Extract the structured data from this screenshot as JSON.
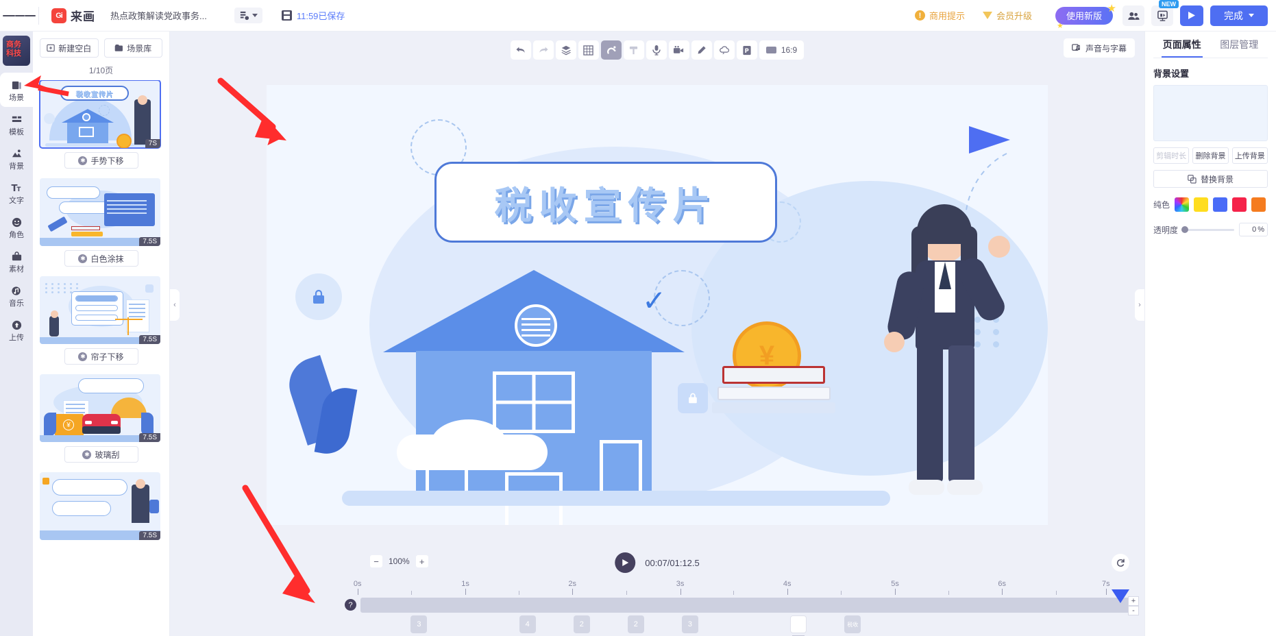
{
  "header": {
    "menu_icon": "hamburger-icon",
    "brand_mark": "Gi",
    "brand_name": "来画",
    "doc_title": "热点政策解读党政事务...",
    "mode_icon": "layout-mode-icon",
    "save_icon": "save-icon",
    "save_status": "11:59已保存",
    "commercial_notice": "商用提示",
    "vip_upgrade": "会员升级",
    "new_version": "使用新版",
    "collab_icon": "collaborators-icon",
    "present_icon": "present-icon",
    "new_badge": "NEW",
    "preview_icon": "play-icon",
    "done_label": "完成"
  },
  "rail": {
    "project_thumb_label": "商务\n科技",
    "items": [
      {
        "label": "场景",
        "icon": "scene-icon",
        "active": true
      },
      {
        "label": "模板",
        "icon": "template-icon",
        "active": false
      },
      {
        "label": "背景",
        "icon": "background-icon",
        "active": false
      },
      {
        "label": "文字",
        "icon": "text-icon",
        "active": false
      },
      {
        "label": "角色",
        "icon": "character-icon",
        "active": false
      },
      {
        "label": "素材",
        "icon": "material-icon",
        "active": false
      },
      {
        "label": "音乐",
        "icon": "music-icon",
        "active": false
      },
      {
        "label": "上传",
        "icon": "upload-icon",
        "active": false
      }
    ]
  },
  "scenes": {
    "new_blank": "新建空白",
    "scene_library": "场景库",
    "page_count": "1/10页",
    "items": [
      {
        "duration": "7S",
        "effect": "手势下移",
        "selected": true
      },
      {
        "duration": "7.5S",
        "effect": "白色涂抹",
        "selected": false
      },
      {
        "duration": "7.5S",
        "effect": "帘子下移",
        "selected": false
      },
      {
        "duration": "7.5S",
        "effect": "玻璃刮",
        "selected": false
      },
      {
        "duration": "7.5S",
        "effect": "",
        "selected": false
      }
    ]
  },
  "toolbar": {
    "buttons": [
      {
        "icon": "undo-icon",
        "name": "undo-button",
        "state": "enabled"
      },
      {
        "icon": "redo-icon",
        "name": "redo-button",
        "state": "disabled"
      },
      {
        "icon": "layers-icon",
        "name": "layers-button",
        "state": "enabled"
      },
      {
        "icon": "grid-icon",
        "name": "grid-button",
        "state": "enabled"
      },
      {
        "icon": "magnet-icon",
        "name": "magnet-button",
        "state": "active"
      },
      {
        "icon": "eraser-icon",
        "name": "eraser-button",
        "state": "disabled"
      },
      {
        "icon": "microphone-icon",
        "name": "record-audio-button",
        "state": "enabled"
      },
      {
        "icon": "video-camera-icon",
        "name": "record-video-button",
        "state": "enabled"
      },
      {
        "icon": "pencil-icon",
        "name": "draw-button",
        "state": "enabled"
      },
      {
        "icon": "cloud-icon",
        "name": "cloud-button",
        "state": "enabled"
      },
      {
        "icon": "ppt-icon",
        "name": "ppt-button",
        "state": "enabled"
      }
    ],
    "ratio_label": "16:9",
    "sound_subtitle": "声音与字幕"
  },
  "stage": {
    "title_text": "税收宣传片",
    "coin_symbol": "¥",
    "lock_glyph": "🔒",
    "check_glyph": "✓",
    "collapse_left_icon": "chevron-left-icon",
    "collapse_right_icon": "chevron-right-icon"
  },
  "timeline": {
    "zoom_out_icon": "minus-icon",
    "zoom_value": "100%",
    "zoom_in_icon": "plus-icon",
    "play_icon": "play-icon",
    "time_display": "00:07/01:12.5",
    "loop_icon": "loop-icon",
    "help_glyph": "?",
    "ticks": [
      "0s",
      "1s",
      "2s",
      "3s",
      "4s",
      "5s",
      "6s",
      "7s"
    ],
    "playhead_position_s": 7,
    "playhead_plus": "+",
    "playhead_minus": "-",
    "layer_chips": [
      {
        "label": "3",
        "pos_pct": 6.5,
        "style": "grey"
      },
      {
        "label": "4",
        "pos_pct": 20.5,
        "style": "grey"
      },
      {
        "label": "2",
        "pos_pct": 27.5,
        "style": "grey"
      },
      {
        "label": "2",
        "pos_pct": 34.5,
        "style": "grey"
      },
      {
        "label": "3",
        "pos_pct": 41.5,
        "style": "grey"
      },
      {
        "label": "",
        "pos_pct": 55.5,
        "style": "white"
      },
      {
        "label": "税收",
        "pos_pct": 62.5,
        "style": "grey"
      }
    ]
  },
  "right_panel": {
    "tabs": [
      {
        "label": "页面属性",
        "active": true
      },
      {
        "label": "图层管理",
        "active": false
      }
    ],
    "section_title": "背景设置",
    "clip_duration": "剪辑时长",
    "delete_background": "删除背景",
    "upload_background": "上传背景",
    "replace_background": "替换背景",
    "replace_icon": "replace-icon",
    "solid_color_label": "纯色",
    "swatches": [
      "rainbow",
      "#FFDD1F",
      "#4A6CF7",
      "#F5234A",
      "#F57C1F"
    ],
    "opacity_label": "透明度",
    "opacity_value": "0",
    "opacity_unit": "%"
  },
  "colors": {
    "accent": "#4E6EF2",
    "panel_bg": "#EEF0F8",
    "rail_bg": "#E8EAF4",
    "annotation": "#FF2D2D"
  }
}
